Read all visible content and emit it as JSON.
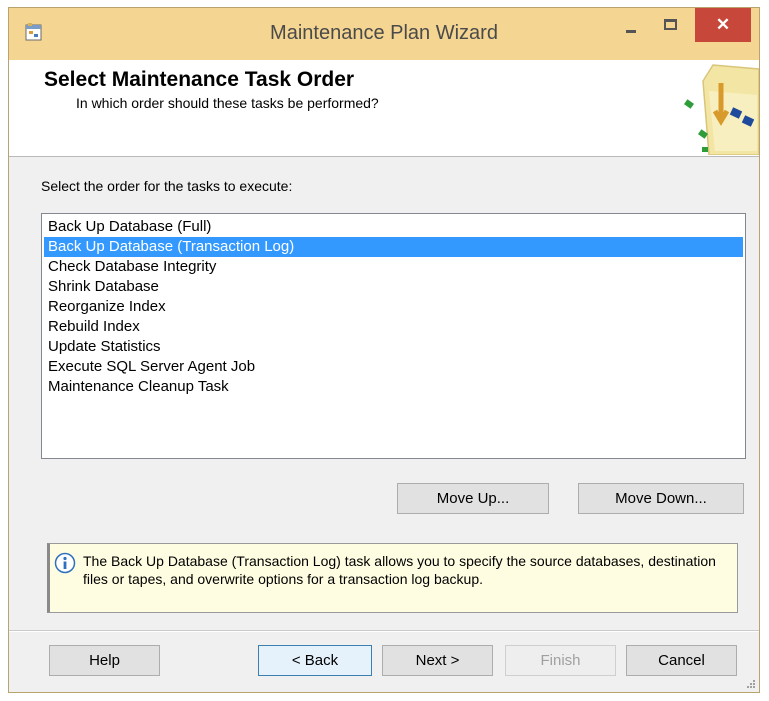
{
  "window": {
    "title": "Maintenance Plan Wizard",
    "close_glyph": "✕",
    "icons": {
      "app": "wizard-app-icon",
      "header_graphic": "task-order-wizard-graphic",
      "info": "info-icon",
      "controls": [
        "minimize-icon",
        "maximize-icon",
        "close-icon"
      ]
    },
    "colors": {
      "titlebar": "#f4d592",
      "close_button": "#c7473a",
      "selection": "#3399ff",
      "info_background": "#fffde1"
    }
  },
  "header": {
    "title": "Select Maintenance Task Order",
    "subtitle": "In which order should these tasks be performed?"
  },
  "prompt": "Select the order for the tasks to execute:",
  "tasks": [
    "Back Up Database (Full)",
    "Back Up Database (Transaction Log)",
    "Check Database Integrity",
    "Shrink Database",
    "Reorganize Index",
    "Rebuild Index",
    "Update Statistics",
    "Execute SQL Server Agent Job",
    "Maintenance Cleanup Task"
  ],
  "selected_task": "Back Up Database (Transaction Log)",
  "buttons": {
    "move_up": "Move Up...",
    "move_down": "Move Down...",
    "help": "Help",
    "back": "< Back",
    "next": "Next >",
    "finish": "Finish",
    "cancel": "Cancel"
  },
  "info": {
    "text": "The Back Up Database (Transaction Log) task allows you to specify the source databases, destination files or tapes, and overwrite options for a transaction log backup."
  }
}
